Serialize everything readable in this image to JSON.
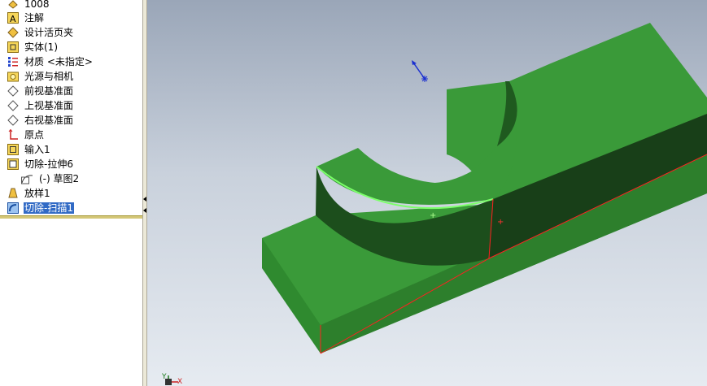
{
  "tree": {
    "root_label": "1008",
    "items": [
      {
        "label": "注解",
        "icon": "annotation-icon"
      },
      {
        "label": "设计活页夹",
        "icon": "design-binder-icon"
      },
      {
        "label": "实体(1)",
        "icon": "solid-body-icon"
      },
      {
        "label": "材质 <未指定>",
        "icon": "material-icon"
      },
      {
        "label": "光源与相机",
        "icon": "lights-camera-icon"
      },
      {
        "label": "前视基准面",
        "icon": "plane-icon"
      },
      {
        "label": "上视基准面",
        "icon": "plane-icon"
      },
      {
        "label": "右视基准面",
        "icon": "plane-icon"
      },
      {
        "label": "原点",
        "icon": "origin-icon"
      },
      {
        "label": "输入1",
        "icon": "imported-feature-icon"
      },
      {
        "label": "切除-拉伸6",
        "icon": "cut-extrude-icon"
      },
      {
        "label": "(-) 草图2",
        "icon": "sketch-icon"
      },
      {
        "label": "放样1",
        "icon": "loft-icon"
      },
      {
        "label": "切除-扫描1",
        "icon": "cut-sweep-icon",
        "selected": true
      }
    ]
  },
  "viewport": {
    "part_color": "#3b9a3a",
    "edge_highlight": "#ff2020",
    "triad_x_label": "X",
    "triad_y_label": "Y"
  }
}
